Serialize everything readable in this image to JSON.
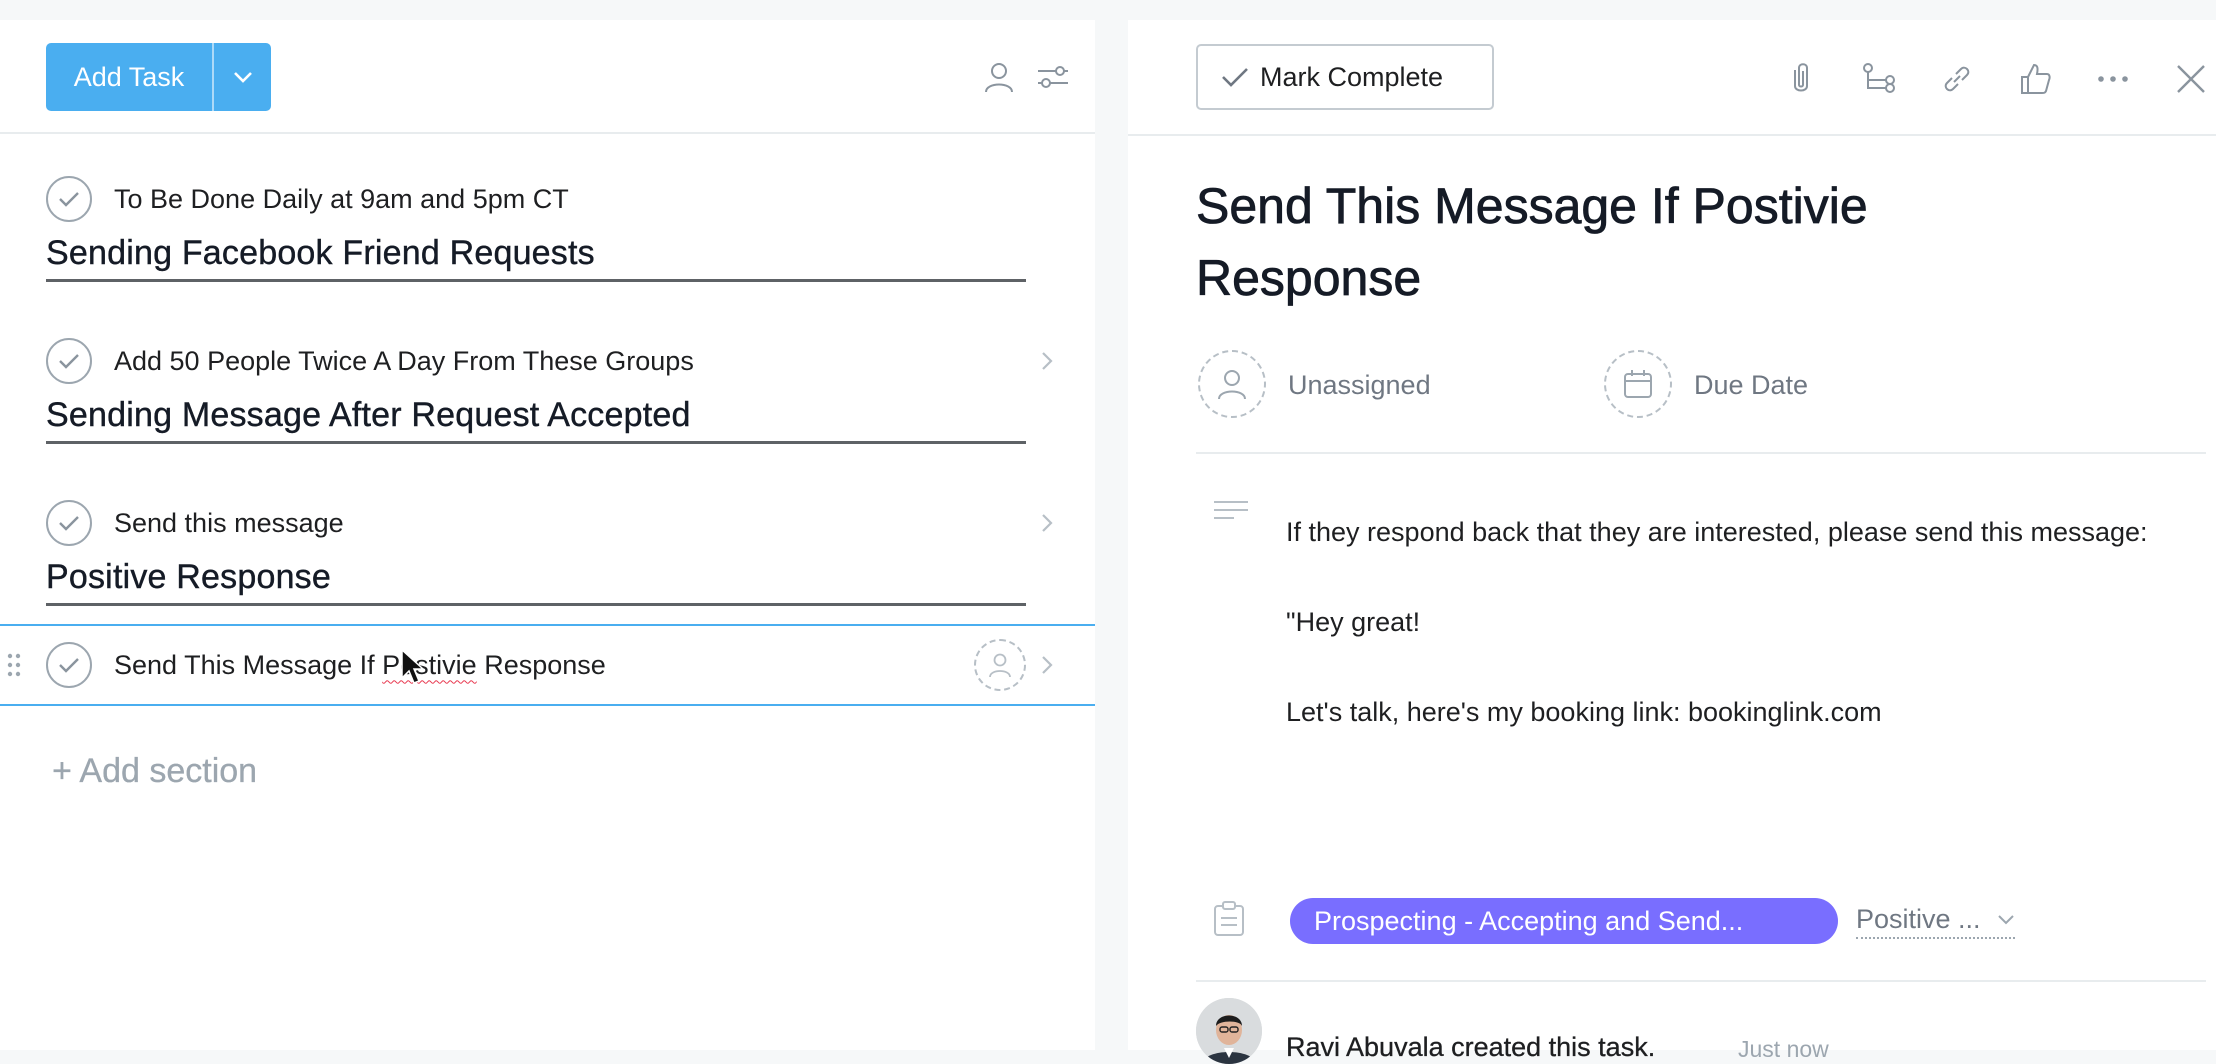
{
  "toolbar": {
    "add_task_label": "Add Task"
  },
  "task_list": {
    "rows": [
      {
        "type": "task",
        "label": "To Be Done Daily at 9am and 5pm CT"
      },
      {
        "type": "section",
        "label": "Sending Facebook Friend Requests"
      },
      {
        "type": "task",
        "label": "Add 50 People Twice A Day From These Groups"
      },
      {
        "type": "section",
        "label": "Sending Message After Request Accepted"
      },
      {
        "type": "task",
        "label": "Send this message"
      },
      {
        "type": "section",
        "label": "Positive Response"
      },
      {
        "type": "task",
        "label_parts": [
          "Send This Message If ",
          "Postivie",
          " Response"
        ],
        "selected": true
      }
    ],
    "add_section_label": "+ Add section"
  },
  "detail": {
    "mark_complete_label": "Mark Complete",
    "title": "Send This Message If Postivie Response",
    "assignee_label": "Unassigned",
    "due_date_label": "Due Date",
    "description": {
      "paragraphs": [
        "If they respond back that they are interested, please send this message:",
        "\"Hey great!",
        "Let's talk, here's my booking link: bookinglink.com"
      ]
    },
    "project": {
      "name": "Prospecting - Accepting and Send...",
      "section": "Positive ...",
      "color": "#796eff"
    },
    "activity": {
      "text": "Ravi Abuvala created this task.",
      "time": "Just now"
    }
  },
  "colors": {
    "accent": "#4aaef0",
    "project_pill": "#796eff",
    "muted_text": "#6f7782"
  }
}
